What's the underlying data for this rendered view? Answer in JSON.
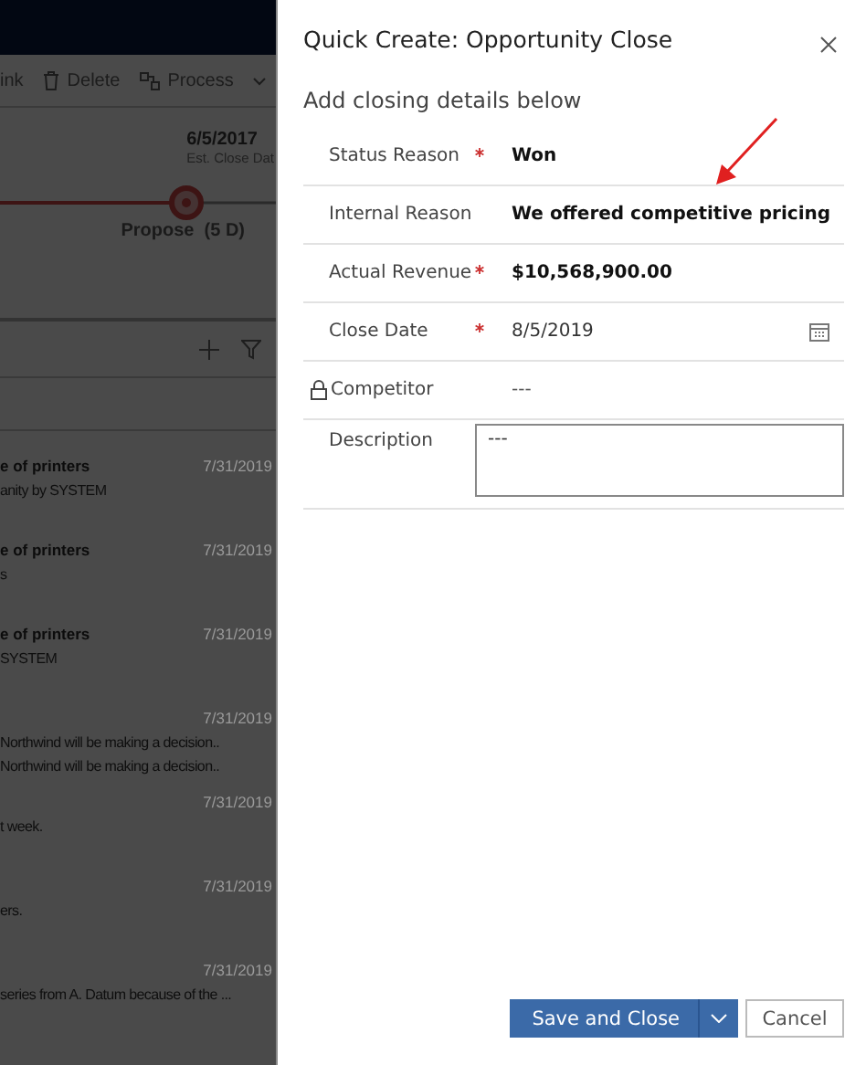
{
  "background": {
    "commands": [
      {
        "label": "ink",
        "kind": "plain"
      },
      {
        "label": "Delete",
        "kind": "trash"
      },
      {
        "label": "Process",
        "kind": "process"
      }
    ],
    "process": {
      "date": "6/5/2017",
      "date_label": "Est. Close Dat",
      "stage": "Propose  (5 D)"
    },
    "timeline": [
      {
        "title": "e of printers",
        "date": "7/31/2019",
        "lines": [
          "anity by SYSTEM"
        ]
      },
      {
        "title": "e of printers",
        "date": "7/31/2019",
        "lines": [
          "s"
        ]
      },
      {
        "title": "e of printers",
        "date": "7/31/2019",
        "lines": [
          "SYSTEM"
        ]
      },
      {
        "date": "7/31/2019",
        "lines": [
          "Northwind will be making a decision..",
          "Northwind will be making a decision.."
        ]
      },
      {
        "date": "7/31/2019",
        "lines": [
          "t week."
        ]
      },
      {
        "date": "7/31/2019",
        "lines": [
          "ers."
        ]
      },
      {
        "date": "7/31/2019",
        "lines": [
          "series from A. Datum because of the ..."
        ]
      }
    ]
  },
  "dialog": {
    "title": "Quick Create: Opportunity Close",
    "subtitle": "Add closing details below",
    "fields": [
      {
        "label": "Status Reason",
        "required": true,
        "locked": false,
        "kind": "choice",
        "value": "Won"
      },
      {
        "label": "Internal Reason",
        "required": false,
        "locked": false,
        "kind": "text",
        "value": "We offered competitive pricing"
      },
      {
        "label": "Actual Revenue",
        "required": true,
        "locked": false,
        "kind": "currency",
        "value": "$10,568,900.00"
      },
      {
        "label": "Close Date",
        "required": true,
        "locked": false,
        "kind": "date",
        "value": "8/5/2019"
      },
      {
        "label": "Competitor",
        "required": false,
        "locked": true,
        "kind": "lookup",
        "value": "---"
      },
      {
        "label": "Description",
        "required": false,
        "locked": false,
        "kind": "multiline",
        "value": "---"
      }
    ],
    "buttons": [
      {
        "label": "Save and Close",
        "kind": "primary"
      },
      {
        "label": "Cancel",
        "kind": "secondary"
      }
    ]
  }
}
